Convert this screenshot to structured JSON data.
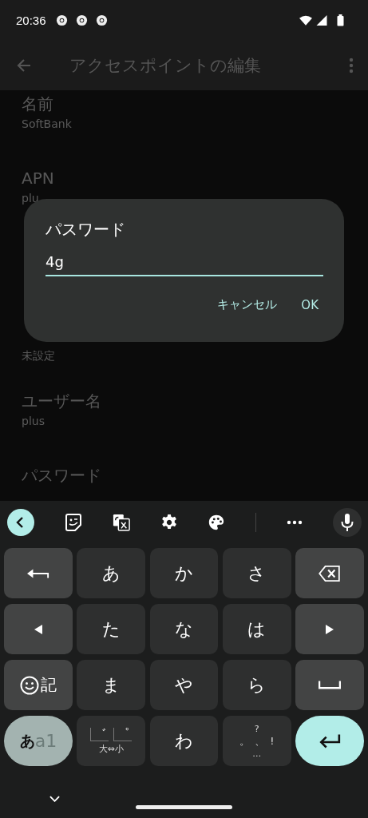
{
  "status_bar": {
    "time": "20:36"
  },
  "app_bar": {
    "title": "アクセスポイントの編集"
  },
  "settings": [
    {
      "label": "名前",
      "value": "SoftBank"
    },
    {
      "label": "APN",
      "value": "plu"
    },
    {
      "value": "未設定"
    },
    {
      "label": "ユーザー名",
      "value": "plus"
    },
    {
      "label": "パスワード"
    }
  ],
  "dialog": {
    "title": "パスワード",
    "value": "4g",
    "buttons": [
      "キャンセル",
      "OK"
    ]
  },
  "keyboard": {
    "rows": [
      [
        {
          "kind": "undo"
        },
        {
          "kind": "char",
          "label": "あ"
        },
        {
          "kind": "char",
          "label": "か"
        },
        {
          "kind": "char",
          "label": "さ"
        },
        {
          "kind": "delete"
        }
      ],
      [
        {
          "kind": "left"
        },
        {
          "kind": "char",
          "label": "た"
        },
        {
          "kind": "char",
          "label": "な"
        },
        {
          "kind": "char",
          "label": "は"
        },
        {
          "kind": "right"
        }
      ],
      [
        {
          "kind": "symbol",
          "label": "記"
        },
        {
          "kind": "char",
          "label": "ま"
        },
        {
          "kind": "char",
          "label": "や"
        },
        {
          "kind": "char",
          "label": "ら"
        },
        {
          "kind": "space"
        }
      ],
      [
        {
          "kind": "mode",
          "labels": [
            "あ",
            "a1"
          ]
        },
        {
          "kind": "dakuten",
          "labels": [
            "゛",
            "゜",
            "大⇔小"
          ]
        },
        {
          "kind": "char",
          "label": "わ"
        },
        {
          "kind": "punct",
          "labels": [
            "?",
            "。",
            "、",
            "!",
            "…"
          ]
        },
        {
          "kind": "enter"
        }
      ]
    ]
  }
}
